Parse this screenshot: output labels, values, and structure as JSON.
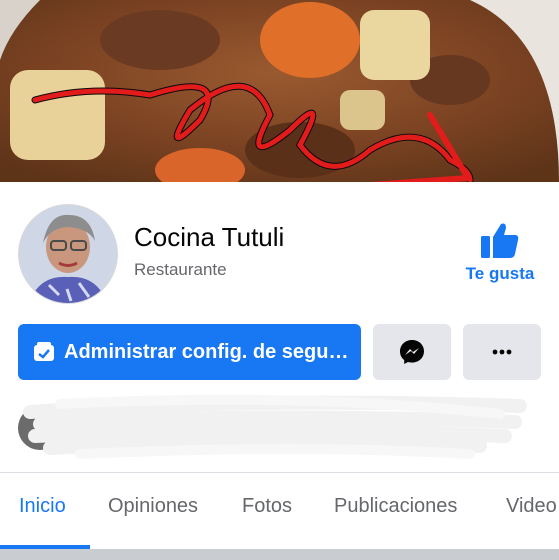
{
  "page": {
    "name": "Cocina Tutuli",
    "category": "Restaurante"
  },
  "actions": {
    "like_label": "Te gusta",
    "manage_label": "Administrar config. de segu…",
    "messenger_icon": "messenger-icon",
    "more_icon": "more-dots-icon"
  },
  "tabs": [
    {
      "label": "Inicio",
      "active": true
    },
    {
      "label": "Opiniones",
      "active": false
    },
    {
      "label": "Fotos",
      "active": false
    },
    {
      "label": "Publicaciones",
      "active": false
    },
    {
      "label": "Video",
      "active": false
    }
  ],
  "colors": {
    "accent": "#1877f2",
    "button_gray": "#e4e6eb",
    "text_secondary": "#65676b",
    "annotation_red": "#e21b1b"
  }
}
